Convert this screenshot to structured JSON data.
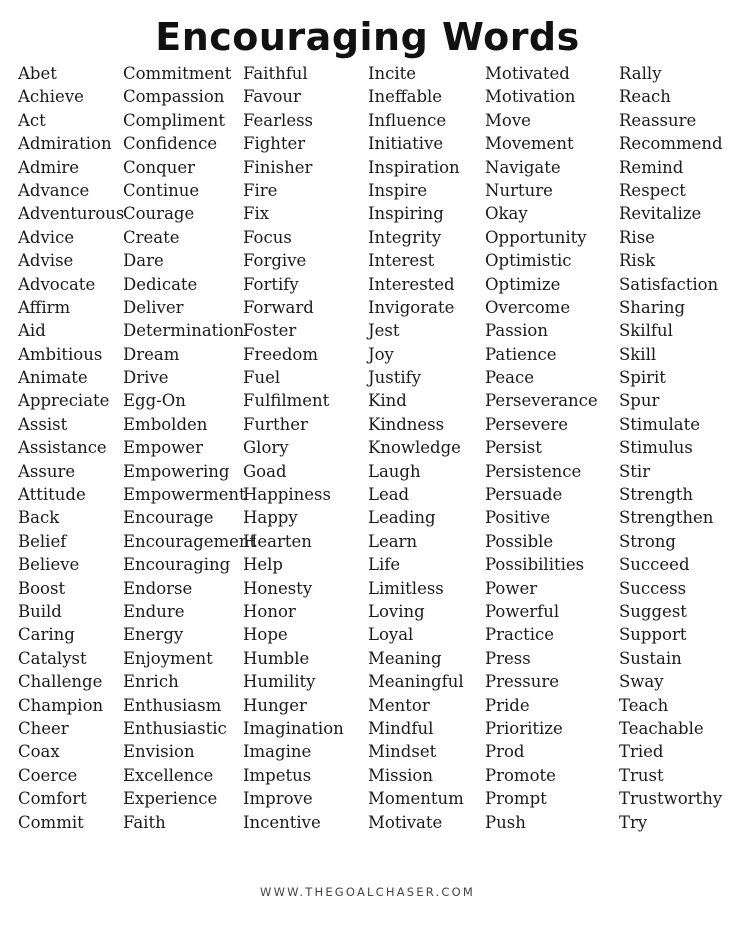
{
  "title": "Encouraging Words",
  "columns": [
    [
      "Abet",
      "Achieve",
      "Act",
      "Admiration",
      "Admire",
      "Advance",
      "Adventurous",
      "Advice",
      "Advise",
      "Advocate",
      "Affirm",
      "Aid",
      "Ambitious",
      "Animate",
      "Appreciate",
      "Assist",
      "Assistance",
      "Assure",
      "Attitude",
      "Back",
      "Belief",
      "Believe",
      "Boost",
      "Build",
      "Caring",
      "Catalyst",
      "Challenge",
      "Champion",
      "Cheer",
      "Coax",
      "Coerce",
      "Comfort",
      "Commit"
    ],
    [
      "Commitment",
      "Compassion",
      "Compliment",
      "Confidence",
      "Conquer",
      "Continue",
      "Courage",
      "Create",
      "Dare",
      "Dedicate",
      "Deliver",
      "Determination",
      "Dream",
      "Drive",
      "Egg-On",
      "Embolden",
      "Empower",
      "Empowering",
      "Empowerment",
      "Encourage",
      "Encouragement",
      "Encouraging",
      "Endorse",
      "Endure",
      "Energy",
      "Enjoyment",
      "Enrich",
      "Enthusiasm",
      "Enthusiastic",
      "Envision",
      "Excellence",
      "Experience",
      "Faith"
    ],
    [
      "Faithful",
      "Favour",
      "Fearless",
      "Fighter",
      "Finisher",
      "Fire",
      "Fix",
      "Focus",
      "Forgive",
      "Fortify",
      "Forward",
      "Foster",
      "Freedom",
      "Fuel",
      "Fulfilment",
      "Further",
      "Glory",
      "Goad",
      "Happiness",
      "Happy",
      "Hearten",
      "Help",
      "Honesty",
      "Honor",
      "Hope",
      "Humble",
      "Humility",
      "Hunger",
      "Imagination",
      "Imagine",
      "Impetus",
      "Improve",
      "Incentive"
    ],
    [
      "Incite",
      "Ineffable",
      "Influence",
      "Initiative",
      "Inspiration",
      "Inspire",
      "Inspiring",
      "Integrity",
      "Interest",
      "Interested",
      "Invigorate",
      "Jest",
      "Joy",
      "Justify",
      "Kind",
      "Kindness",
      "Knowledge",
      "Laugh",
      "Lead",
      "Leading",
      "Learn",
      "Life",
      "Limitless",
      "Loving",
      "Loyal",
      "Meaning",
      "Meaningful",
      "Mentor",
      "Mindful",
      "Mindset",
      "Mission",
      "Momentum",
      "Motivate"
    ],
    [
      "Motivated",
      "Motivation",
      "Move",
      "Movement",
      "Navigate",
      "Nurture",
      "Okay",
      "Opportunity",
      "Optimistic",
      "Optimize",
      "Overcome",
      "Passion",
      "Patience",
      "Peace",
      "Perseverance",
      "Persevere",
      "Persist",
      "Persistence",
      "Persuade",
      "Positive",
      "Possible",
      "Possibilities",
      "Power",
      "Powerful",
      "Practice",
      "Press",
      "Pressure",
      "Pride",
      "Prioritize",
      "Prod",
      "Promote",
      "Prompt",
      "Push"
    ],
    [
      "Rally",
      "Reach",
      "Reassure",
      "Recommend",
      "Remind",
      "Respect",
      "Revitalize",
      "Rise",
      "Risk",
      "Satisfaction",
      "Sharing",
      "Skilful",
      "Skill",
      "Spirit",
      "Spur",
      "Stimulate",
      "Stimulus",
      "Stir",
      "Strength",
      "Strengthen",
      "Strong",
      "Succeed",
      "Success",
      "Suggest",
      "Support",
      "Sustain",
      "Sway",
      "Teach",
      "Teachable",
      "Tried",
      "Trust",
      "Trustworthy",
      "Try"
    ]
  ],
  "footer": "WWW.THEGOALCHASER.COM"
}
